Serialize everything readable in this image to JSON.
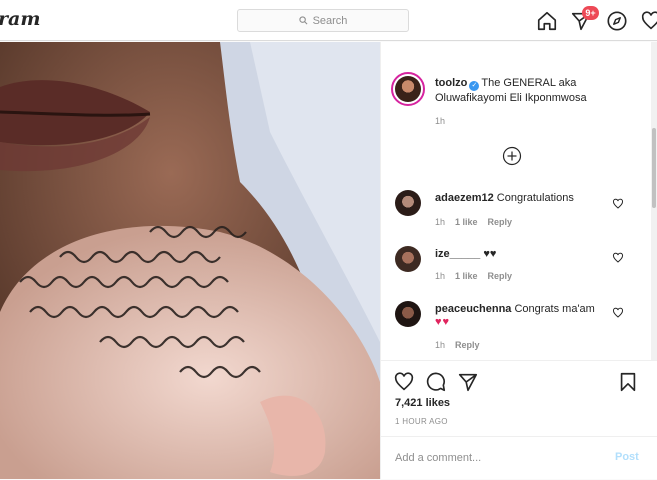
{
  "header": {
    "logo_text": "ram",
    "search_placeholder": "Search",
    "notification_badge": "9+",
    "icons": [
      "home-icon",
      "direct-message-icon",
      "explore-compass-icon",
      "activity-heart-icon"
    ]
  },
  "post": {
    "author": "toolzo",
    "caption": "The GENERAL aka Oluwafikayomi Eli Ikponmwosa",
    "caption_time": "1h",
    "comments": [
      {
        "user": "adaezem12",
        "text": "Congratulations",
        "time": "1h",
        "likes": "1 like",
        "reply": "Reply"
      },
      {
        "user": "ize_____",
        "text": "♥♥",
        "time": "1h",
        "likes": "1 like",
        "reply": "Reply"
      },
      {
        "user": "peaceuchenna",
        "text": "Congrats ma'am",
        "time": "1h",
        "likes": "",
        "reply": "Reply"
      }
    ],
    "likes": "7,421 likes",
    "timestamp": "1 HOUR AGO",
    "add_comment_placeholder": "Add a comment...",
    "post_button": "Post"
  },
  "colors": {
    "badge": "#ed4956",
    "verified": "#3897f0",
    "heart_emoji": "#e0245e",
    "post_disabled": "#b2dffc"
  }
}
